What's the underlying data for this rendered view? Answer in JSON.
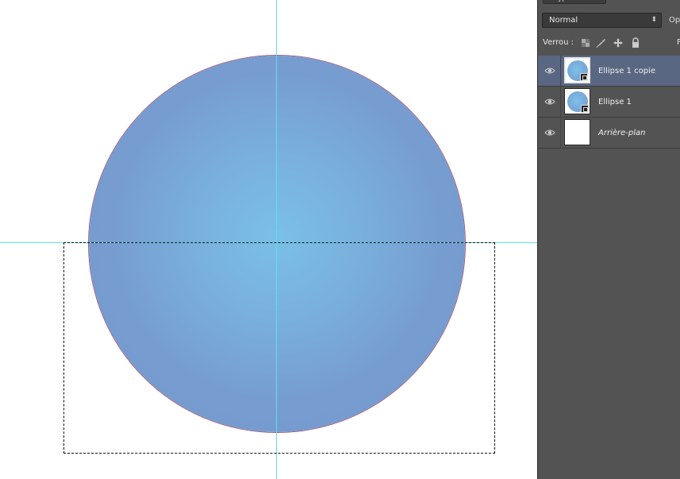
{
  "panel": {
    "filter_type": "Type",
    "blend_mode": "Normal",
    "opacity_label": "Opa",
    "lock_label": "Verrou :",
    "fill_label": "F",
    "layers": [
      {
        "name": "Ellipse 1 copie",
        "visible": true,
        "selected": true,
        "kind": "shape"
      },
      {
        "name": "Ellipse 1",
        "visible": true,
        "selected": false,
        "kind": "shape"
      },
      {
        "name": "Arrière-plan",
        "visible": true,
        "selected": false,
        "kind": "background"
      }
    ]
  },
  "colors": {
    "ellipse_center": "#7ac0e6",
    "ellipse_edge": "#7596cc",
    "guides": "#5fe0f0",
    "panel_bg": "#535353",
    "selected_layer_bg": "#596782"
  }
}
